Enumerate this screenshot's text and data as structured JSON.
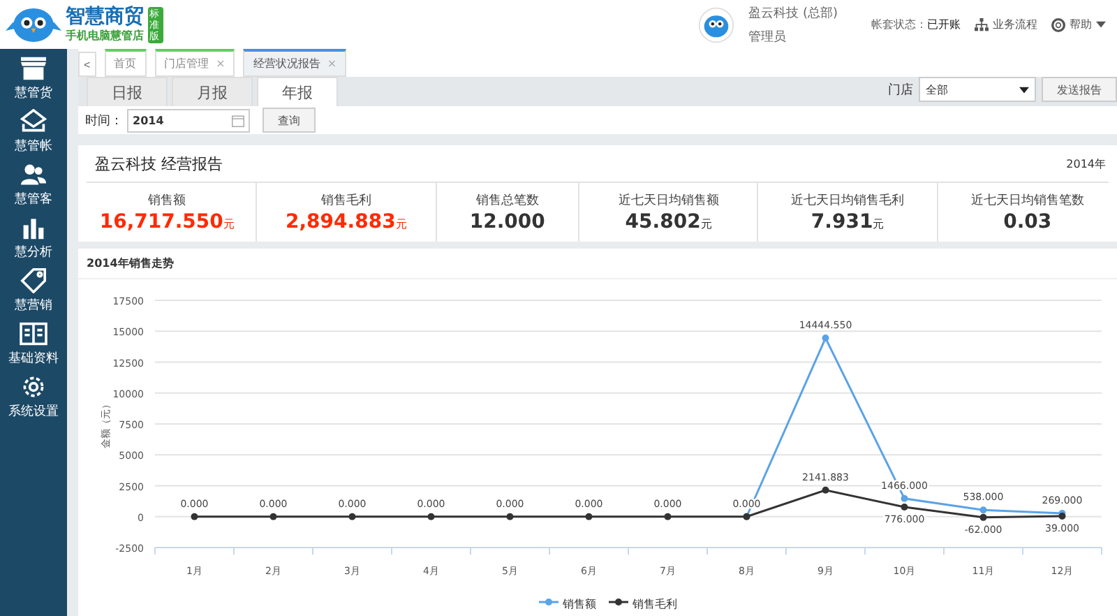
{
  "header": {
    "brand": "智慧商贸",
    "slogan": "手机电脑慧管店",
    "edition": "标准版",
    "company": "盈云科技 (总部)",
    "role": "管理员",
    "account_status_label": "帐套状态：",
    "account_status": "已开账",
    "workflow": "业务流程",
    "help": "帮助"
  },
  "sidebar": {
    "items": [
      {
        "label": "慧管货"
      },
      {
        "label": "慧管帐"
      },
      {
        "label": "慧管客"
      },
      {
        "label": "慧分析"
      },
      {
        "label": "慧营销"
      },
      {
        "label": "基础资料"
      },
      {
        "label": "系统设置"
      }
    ]
  },
  "page_tabs": {
    "back": "<",
    "items": [
      {
        "label": "首页",
        "closable": false,
        "selected": false
      },
      {
        "label": "门店管理",
        "closable": true,
        "selected": false
      },
      {
        "label": "经营状况报告",
        "closable": true,
        "selected": true
      }
    ],
    "close": "×"
  },
  "report_tabs": [
    {
      "label": "日报",
      "selected": false
    },
    {
      "label": "月报",
      "selected": false
    },
    {
      "label": "年报",
      "selected": true
    }
  ],
  "store": {
    "label": "门店",
    "value": "全部",
    "send": "发送报告"
  },
  "query": {
    "label": "时间：",
    "value": "2014",
    "button": "查询"
  },
  "report": {
    "title": "盈云科技 经营报告",
    "period": "2014年",
    "stats": [
      {
        "label": "销售额",
        "value": "16,717.550",
        "unit": "元",
        "highlight": true
      },
      {
        "label": "销售毛利",
        "value": "2,894.883",
        "unit": "元",
        "highlight": true
      },
      {
        "label": "销售总笔数",
        "value": "12.000",
        "highlight": false
      },
      {
        "label": "近七天日均销售额",
        "value": "45.802",
        "unit": "元",
        "highlight": false
      },
      {
        "label": "近七天日均销售毛利",
        "value": "7.931",
        "unit": "元",
        "highlight": false
      },
      {
        "label": "近七天日均销售笔数",
        "value": "0.03",
        "highlight": false
      }
    ]
  },
  "trend": {
    "title": "2014年销售走势",
    "chart_data": {
      "type": "line",
      "ylabel": "金额（元）",
      "categories": [
        "1月",
        "2月",
        "3月",
        "4月",
        "5月",
        "6月",
        "7月",
        "8月",
        "9月",
        "10月",
        "11月",
        "12月"
      ],
      "series": [
        {
          "name": "销售额",
          "color": "#5ba3e6",
          "marker": "circle",
          "values": [
            null,
            null,
            null,
            null,
            null,
            null,
            null,
            0,
            14444.55,
            1466,
            538,
            269
          ],
          "value_labels": [
            null,
            null,
            null,
            null,
            null,
            null,
            null,
            null,
            "14444.550",
            "1466.000",
            "538.000",
            "269.000"
          ]
        },
        {
          "name": "销售毛利",
          "color": "#333333",
          "marker": "circle",
          "values": [
            0,
            0,
            0,
            0,
            0,
            0,
            0,
            0,
            2141.883,
            776,
            -62,
            39
          ],
          "value_labels": [
            "0.000",
            "0.000",
            "0.000",
            "0.000",
            "0.000",
            "0.000",
            "0.000",
            "0.000",
            "2141.883",
            "776.000",
            "-62.000",
            "39.000"
          ]
        }
      ],
      "ylim": [
        -2500,
        17500
      ],
      "yticks": [
        -2500,
        0,
        2500,
        5000,
        7500,
        10000,
        12500,
        15000,
        17500
      ],
      "grid": true,
      "legend": "bottom"
    }
  }
}
